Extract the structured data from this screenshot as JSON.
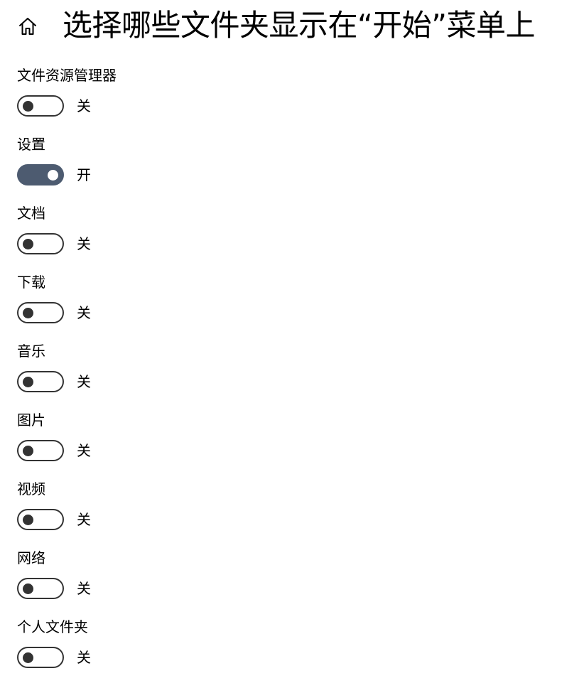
{
  "header": {
    "home_icon": "home-icon",
    "title": "选择哪些文件夹显示在“开始”菜单上"
  },
  "colors": {
    "toggle_on": "#4d5b70",
    "toggle_off_border": "#333333",
    "background": "#ffffff"
  },
  "settings": [
    {
      "label": "文件资源管理器",
      "state": "关",
      "on": false
    },
    {
      "label": "设置",
      "state": "开",
      "on": true
    },
    {
      "label": "文档",
      "state": "关",
      "on": false
    },
    {
      "label": "下载",
      "state": "关",
      "on": false
    },
    {
      "label": "音乐",
      "state": "关",
      "on": false
    },
    {
      "label": "图片",
      "state": "关",
      "on": false
    },
    {
      "label": "视频",
      "state": "关",
      "on": false
    },
    {
      "label": "网络",
      "state": "关",
      "on": false
    },
    {
      "label": "个人文件夹",
      "state": "关",
      "on": false
    }
  ]
}
